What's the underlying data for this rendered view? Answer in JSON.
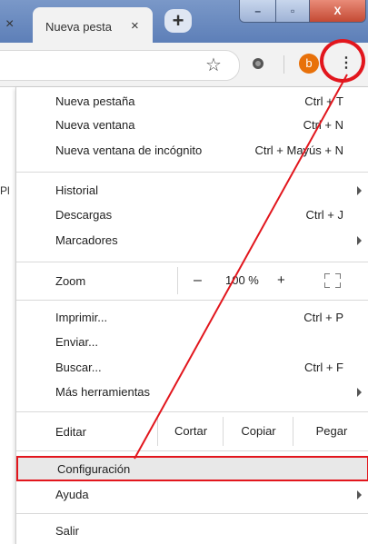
{
  "tabs": {
    "prev_close": "×",
    "active_title": "Nueva pesta",
    "active_close": "×",
    "new_tab": "+"
  },
  "window": {
    "minimize": "–",
    "maximize": "▫",
    "close": "X"
  },
  "toolbar": {
    "avatar_letter": "b",
    "menu_glyph": "⋮",
    "star_glyph": "☆"
  },
  "page_fragment": "Pl",
  "menu": {
    "group1": [
      {
        "label": "Nueva pestaña",
        "shortcut": "Ctrl + T"
      },
      {
        "label": "Nueva ventana",
        "shortcut": "Ctrl + N"
      },
      {
        "label": "Nueva ventana de incógnito",
        "shortcut": "Ctrl + Mayús + N"
      }
    ],
    "group2": [
      {
        "label": "Historial",
        "shortcut": ""
      },
      {
        "label": "Descargas",
        "shortcut": "Ctrl + J"
      },
      {
        "label": "Marcadores",
        "shortcut": ""
      }
    ],
    "zoom": {
      "label": "Zoom",
      "minus": "–",
      "value": "100 %",
      "plus": "+"
    },
    "group3": [
      {
        "label": "Imprimir...",
        "shortcut": "Ctrl + P"
      },
      {
        "label": "Enviar...",
        "shortcut": ""
      },
      {
        "label": "Buscar...",
        "shortcut": "Ctrl + F"
      },
      {
        "label": "Más herramientas",
        "shortcut": ""
      }
    ],
    "edit": {
      "label": "Editar",
      "cut": "Cortar",
      "copy": "Copiar",
      "paste": "Pegar"
    },
    "group4": [
      {
        "label": "Configuración",
        "shortcut": ""
      },
      {
        "label": "Ayuda",
        "shortcut": ""
      }
    ],
    "exit": {
      "label": "Salir"
    }
  },
  "colors": {
    "annotation": "#e2161d",
    "avatar": "#e8710a",
    "highlight_bg": "#e8e8e8"
  }
}
